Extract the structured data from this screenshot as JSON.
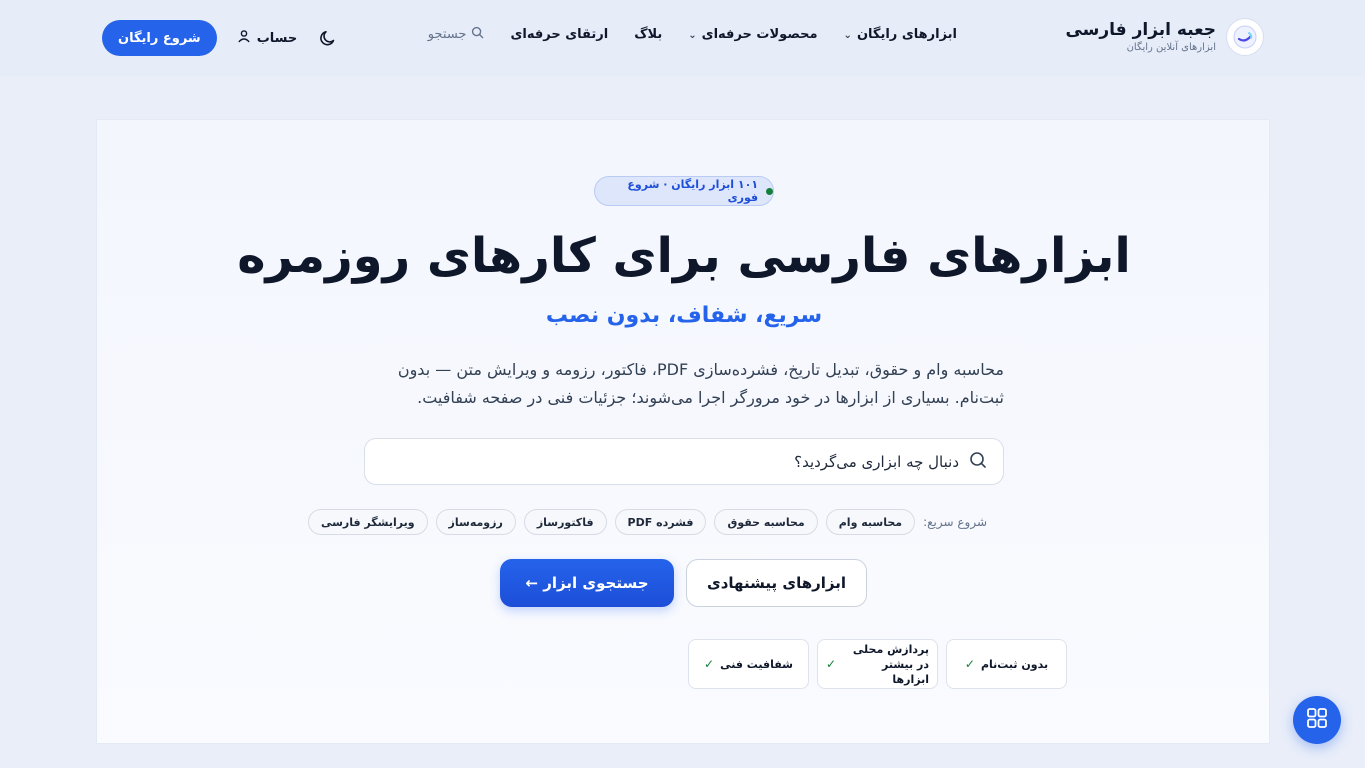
{
  "brand": {
    "title": "جعبه ابزار فارسی",
    "subtitle": "ابزارهای آنلاین رایگان"
  },
  "nav": {
    "items": [
      {
        "label": "ابزارهای رایگان",
        "has_dropdown": true
      },
      {
        "label": "محصولات حرفه‌ای",
        "has_dropdown": true
      },
      {
        "label": "بلاگ",
        "has_dropdown": false
      },
      {
        "label": "ارتقای حرفه‌ای",
        "has_dropdown": false
      }
    ],
    "search_label": "جستجو"
  },
  "header": {
    "start_free_label": "شروع رایگان",
    "account_label": "حساب",
    "theme_icon": "moon-icon"
  },
  "hero": {
    "pill_text": "۱۰۱ ابزار رایگان · شروع فوری",
    "title": "ابزارهای فارسی برای کارهای روزمره",
    "subtitle": "سریع، شفاف، بدون نصب",
    "description": "محاسبه وام و حقوق، تبدیل تاریخ، فشرده‌سازی PDF، فاکتور، رزومه و ویرایش متن — بدون ثبت‌نام. بسیاری از ابزارها در خود مرورگر اجرا می‌شوند؛ جزئیات فنی در صفحه شفافیت.",
    "search_placeholder": "دنبال چه ابزاری می‌گردید؟",
    "quick_start_label": "شروع سریع:",
    "quick_chips": [
      "محاسبه وام",
      "محاسبه حقوق",
      "فشرده PDF",
      "فاکتورساز",
      "رزومه‌ساز",
      "ویرایشگر فارسی"
    ],
    "primary_cta": "جستجوی ابزار ←",
    "secondary_cta": "ابزارهای پیشنهادی",
    "features": [
      "بدون ثبت‌نام",
      "پردازش محلی در بیشتر ابزارها",
      "شفافیت فنی"
    ]
  },
  "colors": {
    "accent": "#2563eb",
    "success": "#15803d",
    "background": "#e9eef9"
  },
  "fab_icon": "grid-icon"
}
